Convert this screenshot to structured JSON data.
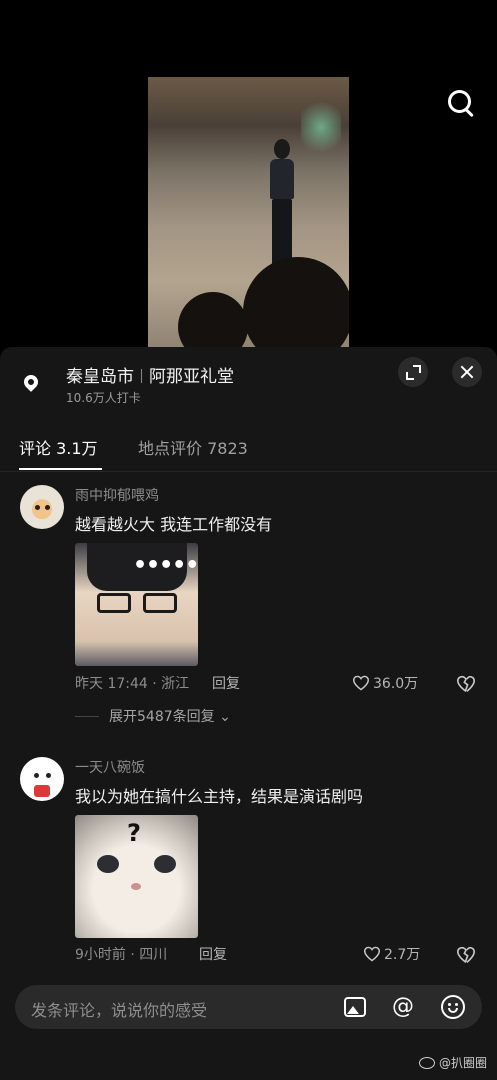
{
  "location": {
    "city": "秦皇岛市",
    "place": "阿那亚礼堂",
    "checkins": "10.6万人打卡"
  },
  "tabs": [
    {
      "label": "评论 3.1万"
    },
    {
      "label": "地点评价 7823"
    }
  ],
  "comments": [
    {
      "username": "雨中抑郁喂鸡",
      "text": "越看越火大 我连工作都没有",
      "image_overlay": "••••••",
      "meta": "昨天 17:44 · 浙江",
      "reply_label": "回复",
      "likes": "36.0万",
      "expand_replies": "展开5487条回复"
    },
    {
      "username": "一天八碗饭",
      "text": "我以为她在搞什么主持，结果是演话剧吗",
      "image_overlay": "?",
      "meta": "9小时前 · 四川",
      "reply_label": "回复",
      "likes": "2.7万"
    }
  ],
  "input": {
    "placeholder": "发条评论，说说你的感受",
    "at_symbol": "@"
  },
  "watermark": "@扒圈圈",
  "icons": [
    "search-icon",
    "location-pin-icon",
    "expand-icon",
    "close-icon",
    "heart-icon",
    "dislike-icon",
    "image-icon",
    "at-icon",
    "emoji-icon"
  ]
}
